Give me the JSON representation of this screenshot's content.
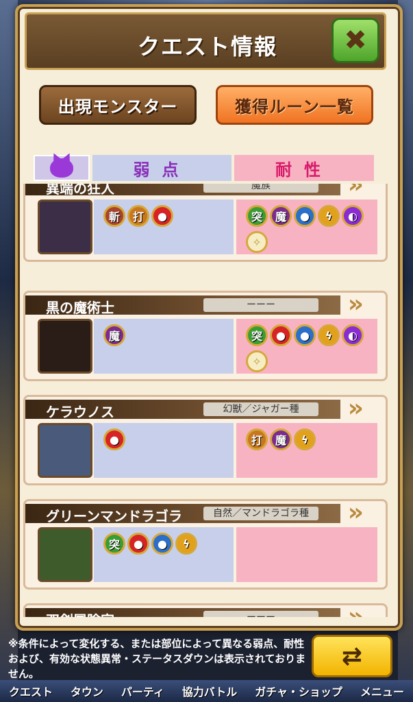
{
  "header": {
    "title": "クエスト情報",
    "close_label": "✖"
  },
  "tabs": {
    "monsters": "出現モンスター",
    "runes": "獲得ルーン一覧"
  },
  "columns": {
    "weak": "弱点",
    "resist": "耐性"
  },
  "monsters": [
    {
      "name": "異端の狂人",
      "type": "魔族",
      "weak": [
        [
          "斬",
          "slash"
        ],
        [
          "打",
          "blunt"
        ],
        [
          "",
          "fire"
        ]
      ],
      "resist": [
        [
          "突",
          "pierce"
        ],
        [
          "魔",
          "magic"
        ],
        [
          "",
          "water"
        ],
        [
          "",
          "thunder"
        ],
        [
          "",
          "dark"
        ],
        [
          "",
          "light"
        ]
      ]
    },
    {
      "name": "黒の魔術士",
      "type": "ーーー",
      "weak": [
        [
          "魔",
          "magic"
        ]
      ],
      "resist": [
        [
          "突",
          "pierce"
        ],
        [
          "",
          "fire"
        ],
        [
          "",
          "water"
        ],
        [
          "",
          "thunder"
        ],
        [
          "",
          "dark"
        ],
        [
          "",
          "light"
        ]
      ]
    },
    {
      "name": "ケラウノス",
      "type": "幻獣／ジャガー種",
      "weak": [
        [
          "",
          "fire"
        ]
      ],
      "resist": [
        [
          "打",
          "blunt"
        ],
        [
          "魔",
          "magic"
        ],
        [
          "",
          "thunder"
        ]
      ]
    },
    {
      "name": "グリーンマンドラゴラ",
      "type": "自然／マンドラゴラ種",
      "weak": [
        [
          "突",
          "pierce"
        ],
        [
          "",
          "fire"
        ],
        [
          "",
          "water"
        ],
        [
          "",
          "thunder"
        ]
      ],
      "resist": []
    },
    {
      "name": "双剣冒険家",
      "type": "ーーー",
      "weak": [],
      "resist": []
    }
  ],
  "footer": {
    "note": "※条件によって変化する、または部位によって異なる弱点、耐性および、有効な状態異常・ステータスダウンは表示されておりません。"
  },
  "nav": [
    "クエスト",
    "タウン",
    "パーティ",
    "協力バトル",
    "ガチャ・ショップ",
    "メニュー"
  ]
}
